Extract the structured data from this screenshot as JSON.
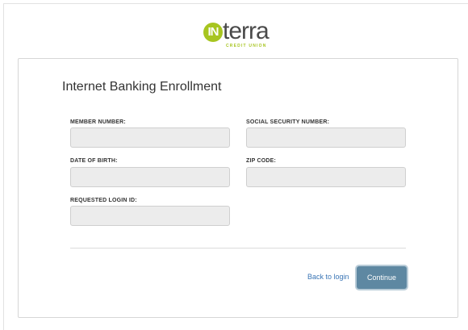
{
  "brand": {
    "logo_mark": "IN",
    "logo_word": "terra",
    "logo_sub": "CREDIT UNION",
    "accent_color": "#a7c520",
    "logo_icon": "interra-logo-icon"
  },
  "form": {
    "title": "Internet Banking Enrollment",
    "fields": {
      "member_number": {
        "label": "MEMBER NUMBER:",
        "value": ""
      },
      "ssn": {
        "label": "SOCIAL SECURITY NUMBER:",
        "value": ""
      },
      "dob": {
        "label": "DATE OF BIRTH:",
        "value": ""
      },
      "zip": {
        "label": "ZIP CODE:",
        "value": ""
      },
      "login_id": {
        "label": "REQUESTED LOGIN ID:",
        "value": ""
      }
    },
    "back_link": "Back to login",
    "continue_label": "Continue",
    "button_color": "#5e88a2",
    "link_color": "#3a75b5"
  }
}
